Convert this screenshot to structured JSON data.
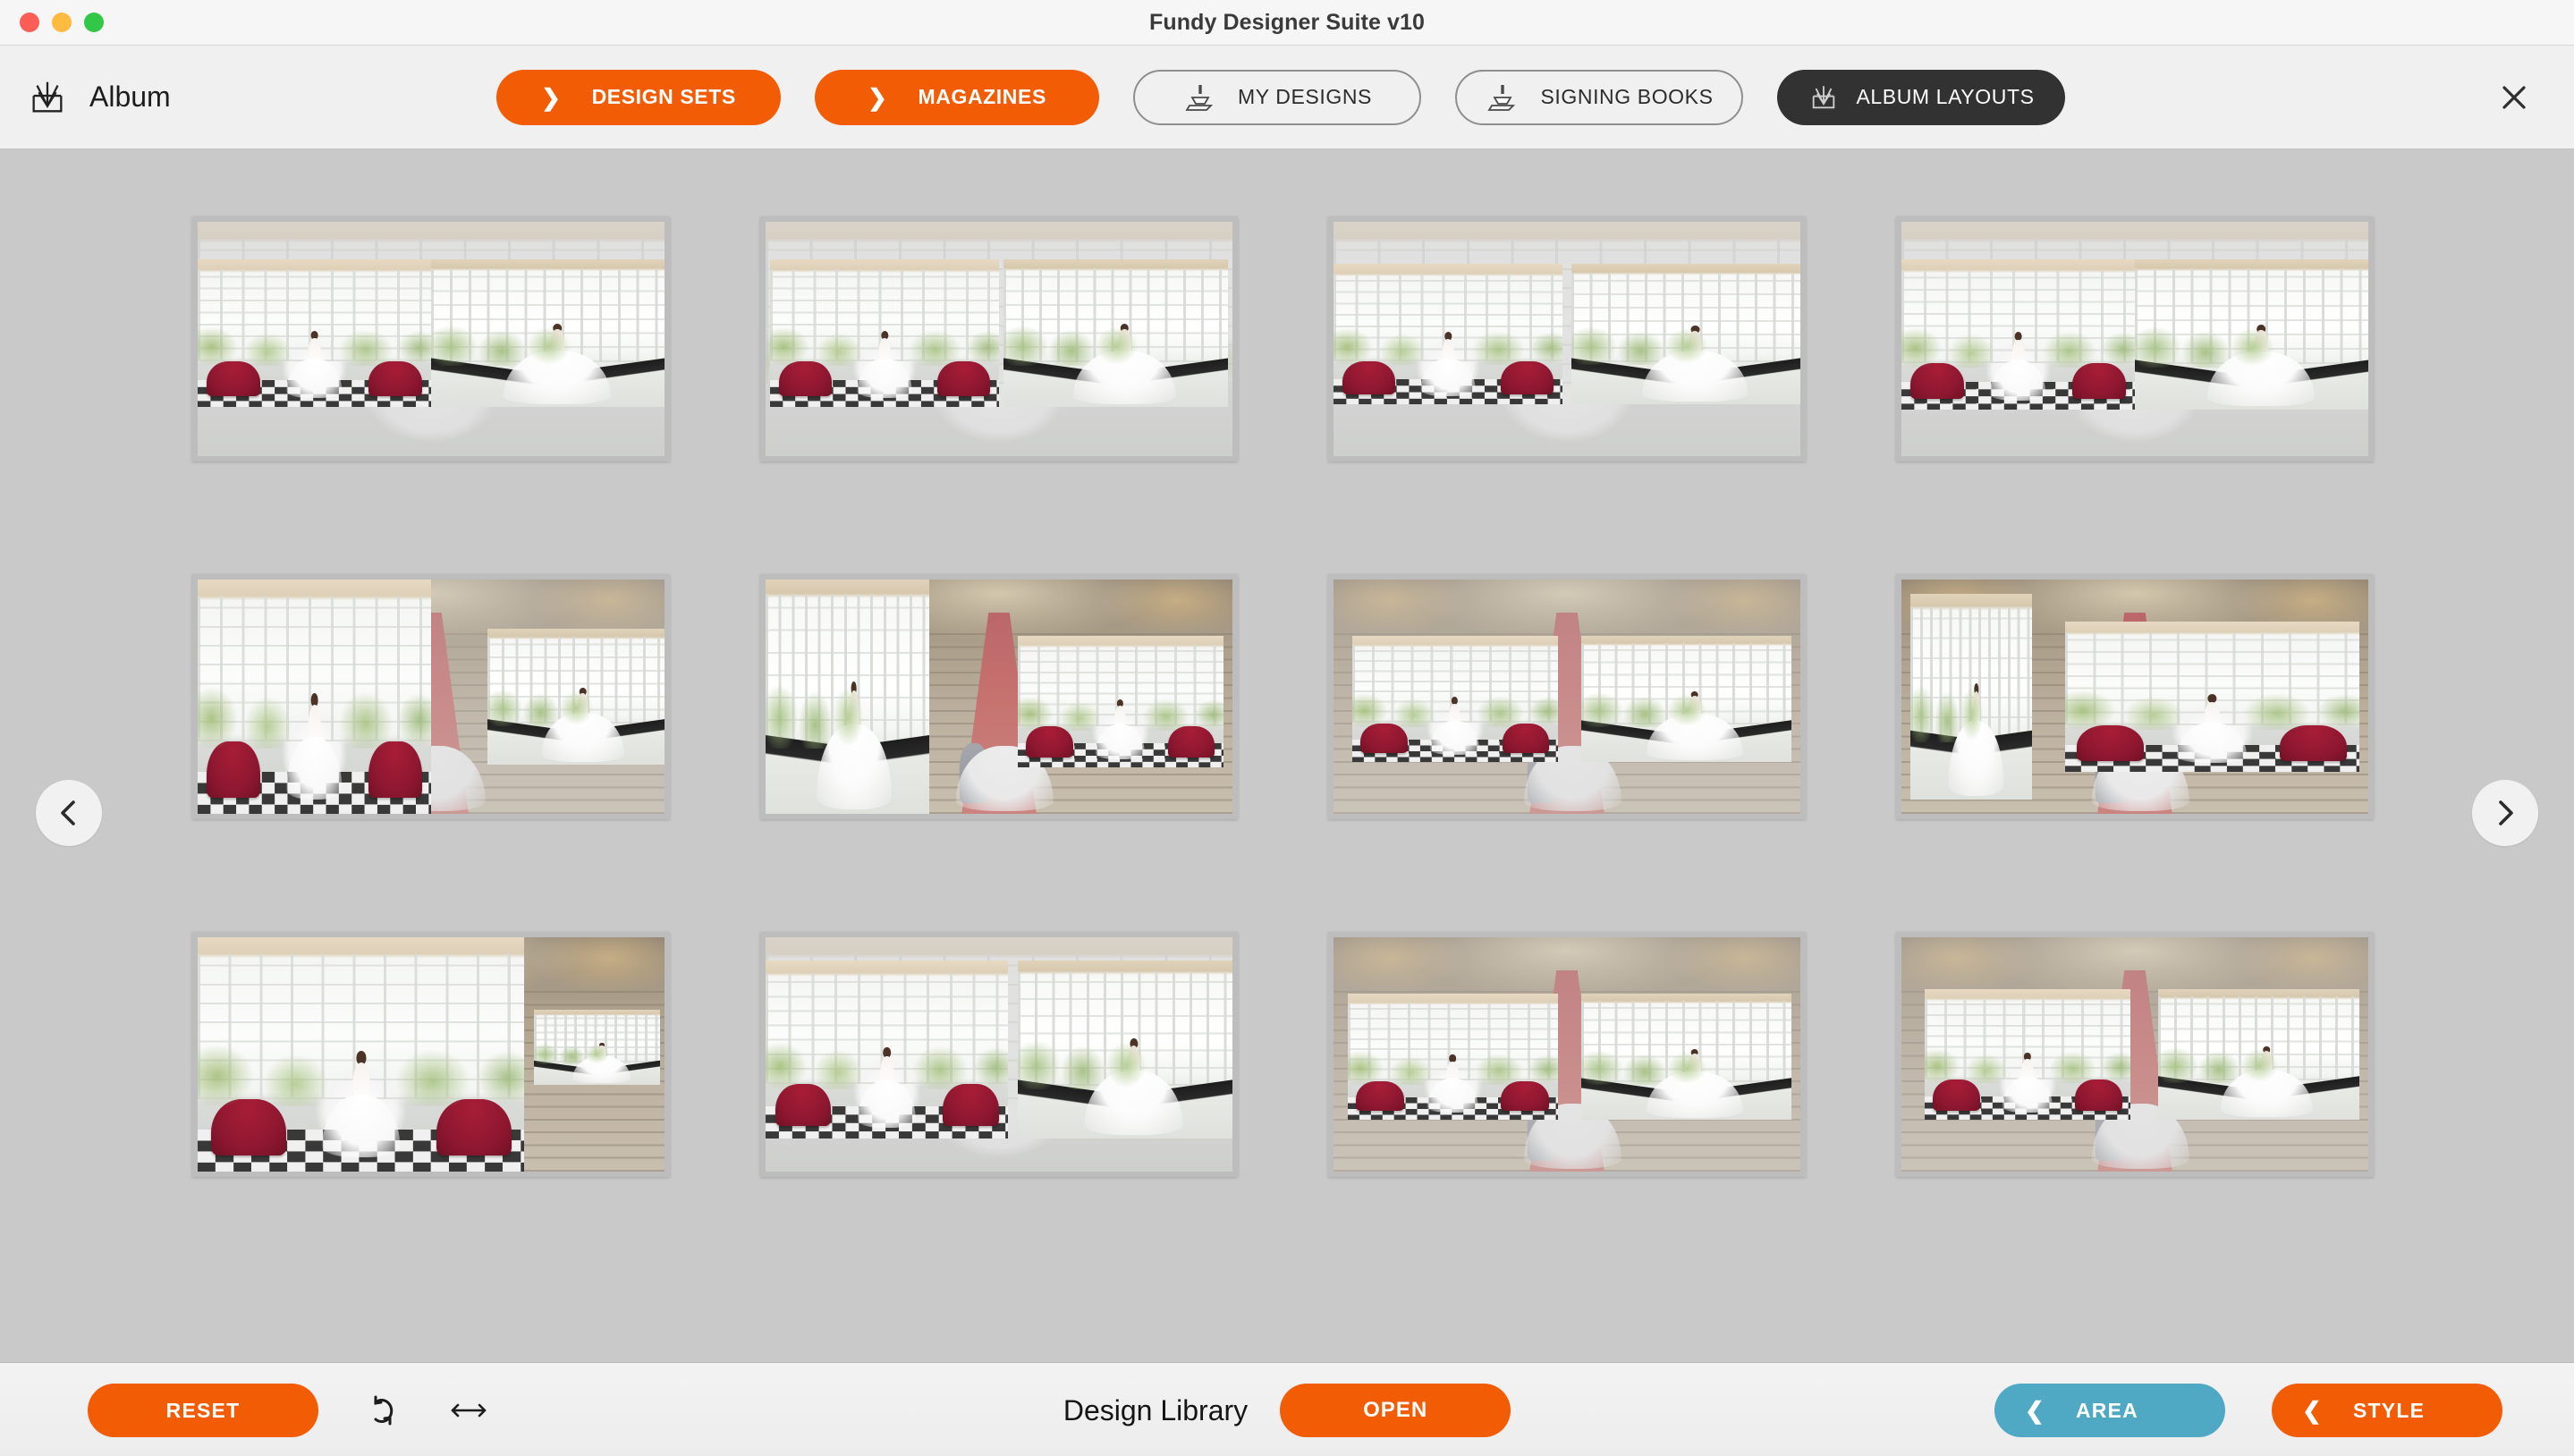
{
  "window": {
    "title": "Fundy Designer Suite v10",
    "traffic_lights": [
      "close",
      "minimize",
      "maximize"
    ]
  },
  "header": {
    "module_label": "Album",
    "module_icon": "album-icon",
    "buttons": [
      {
        "id": "design-sets",
        "label": "DESIGN SETS",
        "style": "orange",
        "icon": "chevron-right-icon"
      },
      {
        "id": "magazines",
        "label": "MAGAZINES",
        "style": "orange",
        "icon": "chevron-right-icon"
      },
      {
        "id": "my-designs",
        "label": "MY DESIGNS",
        "style": "outline",
        "icon": "stamp-icon"
      },
      {
        "id": "signing-books",
        "label": "SIGNING BOOKS",
        "style": "outline",
        "icon": "stamp-icon"
      },
      {
        "id": "album-layouts",
        "label": "ALBUM LAYOUTS",
        "style": "dark",
        "icon": "album-icon",
        "active": true
      }
    ],
    "close_icon": "close-icon"
  },
  "gallery": {
    "prev_icon": "chevron-left-icon",
    "next_icon": "chevron-right-icon",
    "layouts": [
      {
        "id": "layout-1",
        "variant": "full-bleed-band",
        "row": 1,
        "col": 1
      },
      {
        "id": "layout-2",
        "variant": "full-bleed-band",
        "row": 1,
        "col": 2
      },
      {
        "id": "layout-3",
        "variant": "full-bleed-band",
        "row": 1,
        "col": 3
      },
      {
        "id": "layout-4",
        "variant": "full-bleed-band",
        "row": 1,
        "col": 4
      },
      {
        "id": "layout-5",
        "variant": "split-two-up",
        "row": 2,
        "col": 1
      },
      {
        "id": "layout-6",
        "variant": "left-photo-inset",
        "row": 2,
        "col": 2
      },
      {
        "id": "layout-7",
        "variant": "centered-band",
        "row": 2,
        "col": 3
      },
      {
        "id": "layout-8",
        "variant": "stair-bleed-inset",
        "row": 2,
        "col": 4
      },
      {
        "id": "layout-9",
        "variant": "large-left-inset",
        "row": 3,
        "col": 1
      },
      {
        "id": "layout-10",
        "variant": "split-two-up",
        "row": 3,
        "col": 2
      },
      {
        "id": "layout-11",
        "variant": "centered-band",
        "row": 3,
        "col": 3
      },
      {
        "id": "layout-12",
        "variant": "centered-band",
        "row": 3,
        "col": 4
      }
    ]
  },
  "footer": {
    "reset_label": "RESET",
    "rotate_icon": "rotate-icon",
    "flip_icon": "horizontal-arrows-icon",
    "library_label": "Design Library",
    "open_label": "OPEN",
    "area_label": "AREA",
    "style_label": "STYLE",
    "area_icon": "chevron-left-icon",
    "style_icon": "chevron-left-icon"
  },
  "colors": {
    "accent_orange": "#f25c05",
    "accent_teal": "#4fa8c4",
    "dark_pill": "#323232",
    "canvas": "#c9c9c9"
  }
}
